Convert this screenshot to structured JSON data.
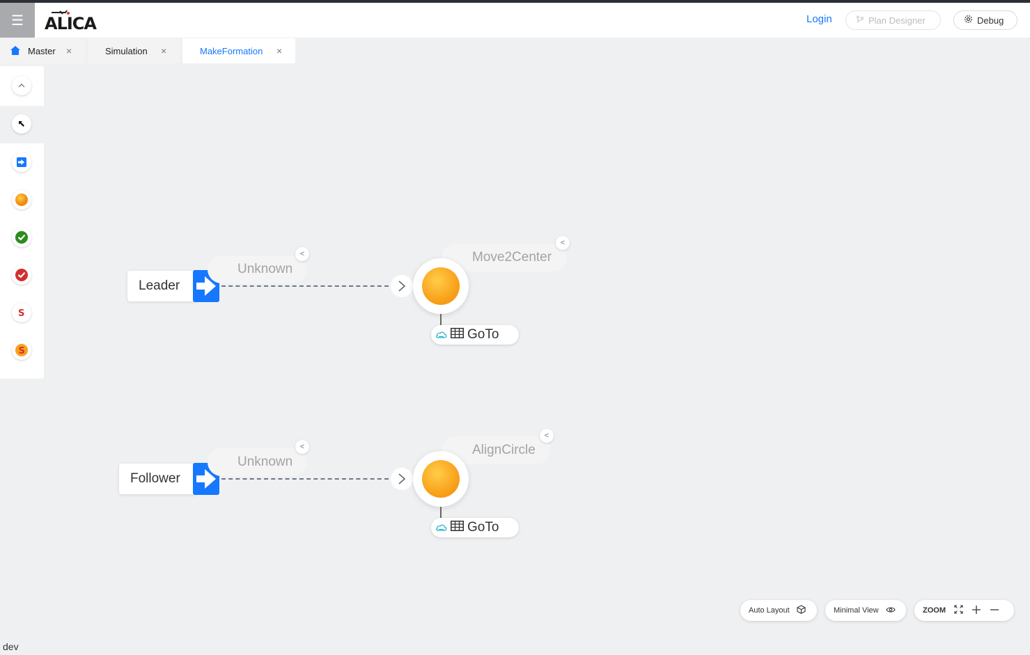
{
  "app": {
    "logo_text": "ALICA",
    "menu_icon": "hamburger-icon"
  },
  "header": {
    "login_label": "Login",
    "plan_designer_label": "Plan Designer",
    "debug_label": "Debug"
  },
  "tabs": [
    {
      "label": "Master",
      "icon": "home-icon",
      "active": false
    },
    {
      "label": "Simulation",
      "active": false
    },
    {
      "label": "MakeFormation",
      "active": true
    }
  ],
  "toolbox": {
    "items": [
      "collapse-icon",
      "select-pointer-icon",
      "entry-point-icon",
      "state-icon",
      "success-state-icon",
      "failure-state-icon",
      "synchronisation-icon",
      "sync-transition-icon"
    ]
  },
  "plan": {
    "rows": [
      {
        "entry_label": "Leader",
        "task_label": "Unknown",
        "state_label": "Move2Center",
        "behaviour_label": "GoTo"
      },
      {
        "entry_label": "Follower",
        "task_label": "Unknown",
        "state_label": "AlignCircle",
        "behaviour_label": "GoTo"
      }
    ]
  },
  "controls": {
    "auto_layout_label": "Auto Layout",
    "minimal_view_label": "Minimal View",
    "zoom_label": "ZOOM"
  },
  "footer": {
    "env_label": "dev"
  },
  "colors": {
    "accent": "#1677ff",
    "state_orange": "#f9a21b",
    "success_green": "#2e8b1f",
    "failure_red": "#d32f2f"
  }
}
